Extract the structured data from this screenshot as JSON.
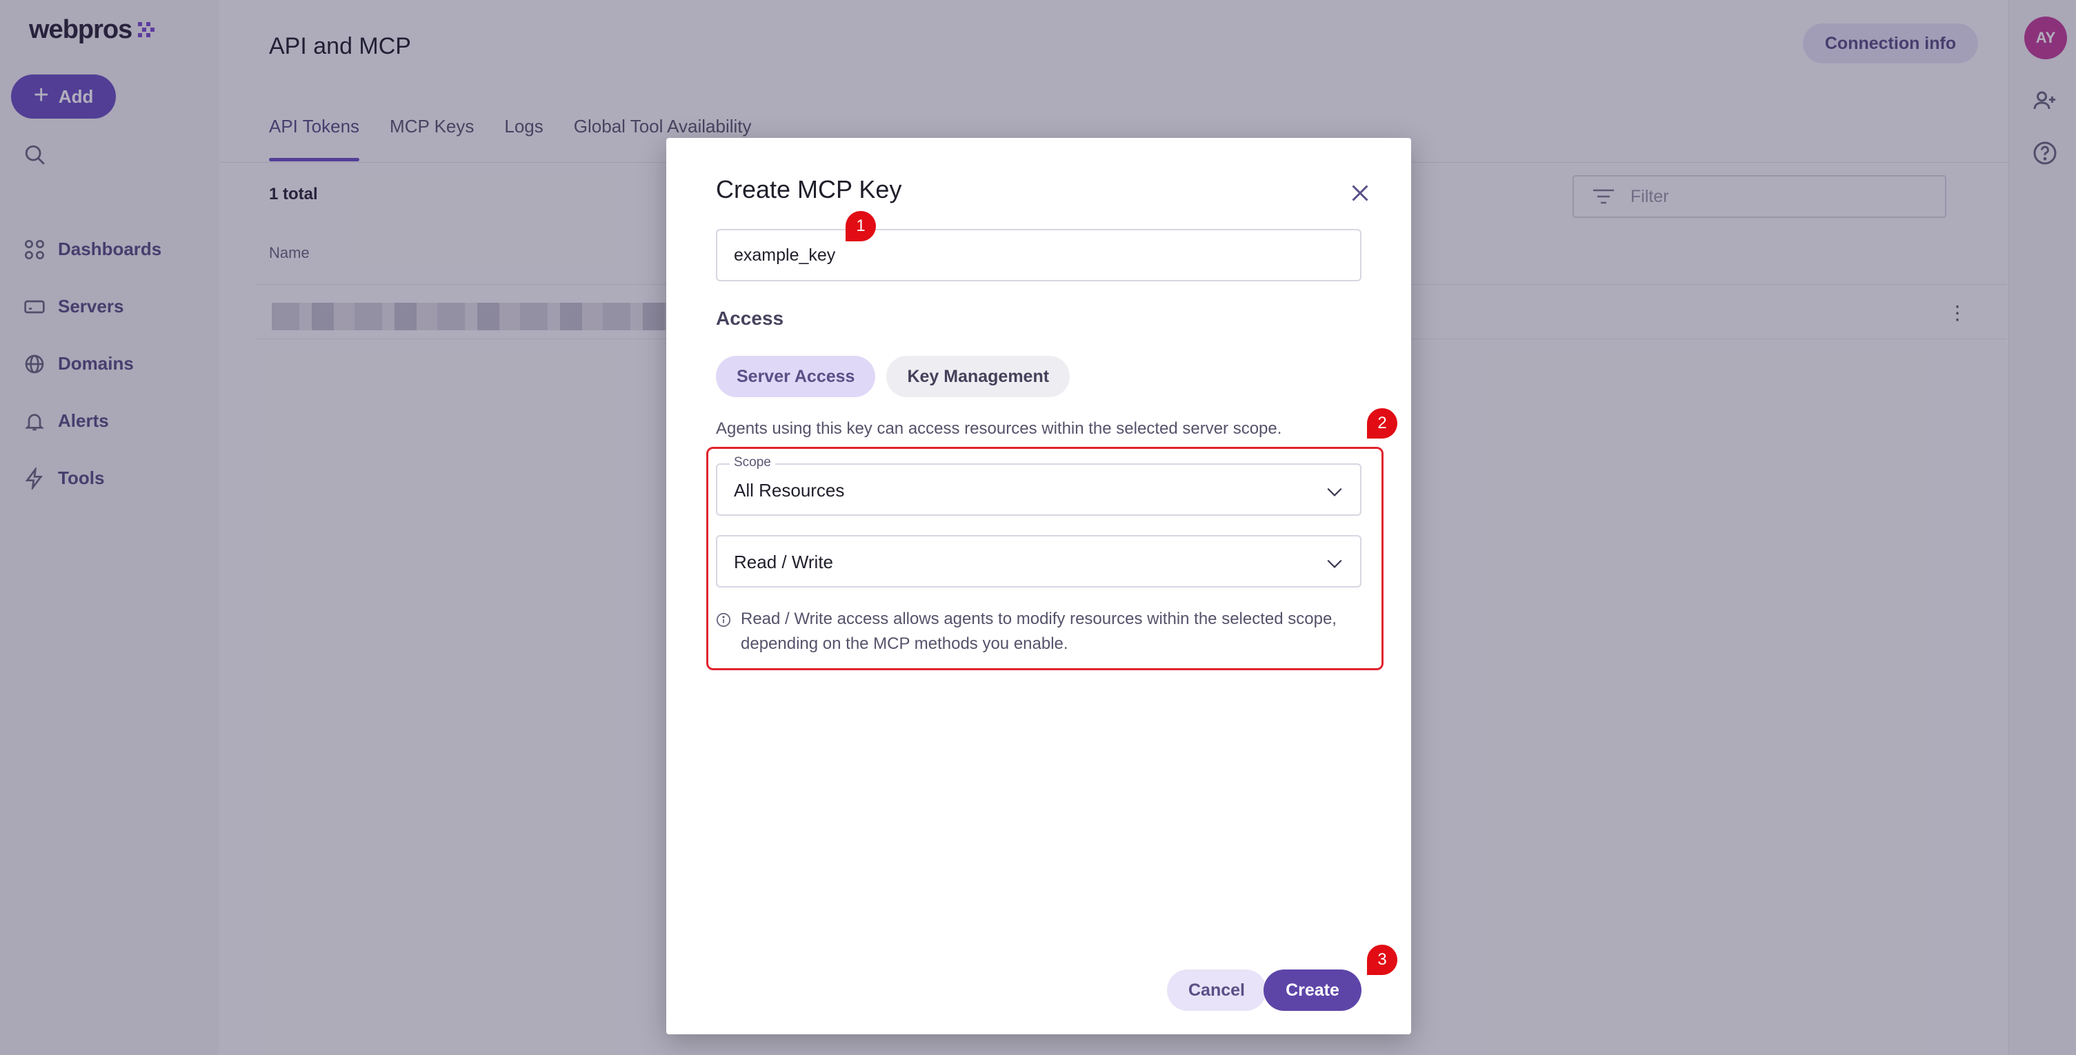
{
  "app": {
    "logo_text": "webpros",
    "add_label": "Add",
    "nav": [
      {
        "label": "Dashboards",
        "icon": "grid-icon"
      },
      {
        "label": "Servers",
        "icon": "server-icon"
      },
      {
        "label": "Domains",
        "icon": "globe-icon"
      },
      {
        "label": "Alerts",
        "icon": "bell-icon"
      },
      {
        "label": "Tools",
        "icon": "bolt-icon"
      }
    ]
  },
  "header": {
    "title": "API and MCP",
    "connection_info": "Connection info",
    "tabs": [
      "API Tokens",
      "MCP Keys",
      "Logs",
      "Global Tool Availability"
    ],
    "active_tab": "API Tokens"
  },
  "content": {
    "total": "1 total",
    "filter_placeholder": "Filter",
    "column_name": "Name"
  },
  "rail": {
    "avatar_initials": "AY"
  },
  "modal": {
    "title": "Create MCP Key",
    "key_value": "example_key",
    "access_label": "Access",
    "segments": [
      {
        "label": "Server Access",
        "selected": true
      },
      {
        "label": "Key Management",
        "selected": false
      }
    ],
    "description": "Agents using this key can access resources within the selected server scope.",
    "scope_label": "Scope",
    "scope_value": "All Resources",
    "permission_value": "Read / Write",
    "info_text": "Read / Write access allows agents to modify resources within the selected scope, depending on the MCP methods you enable.",
    "cancel_label": "Cancel",
    "create_label": "Create"
  },
  "markers": [
    "1",
    "2",
    "3"
  ],
  "colors": {
    "accent": "#6b4fc3",
    "primary_button": "#5d45a8",
    "highlight": "#e0242e",
    "marker": "#e10c14",
    "avatar": "#c43c9a"
  }
}
